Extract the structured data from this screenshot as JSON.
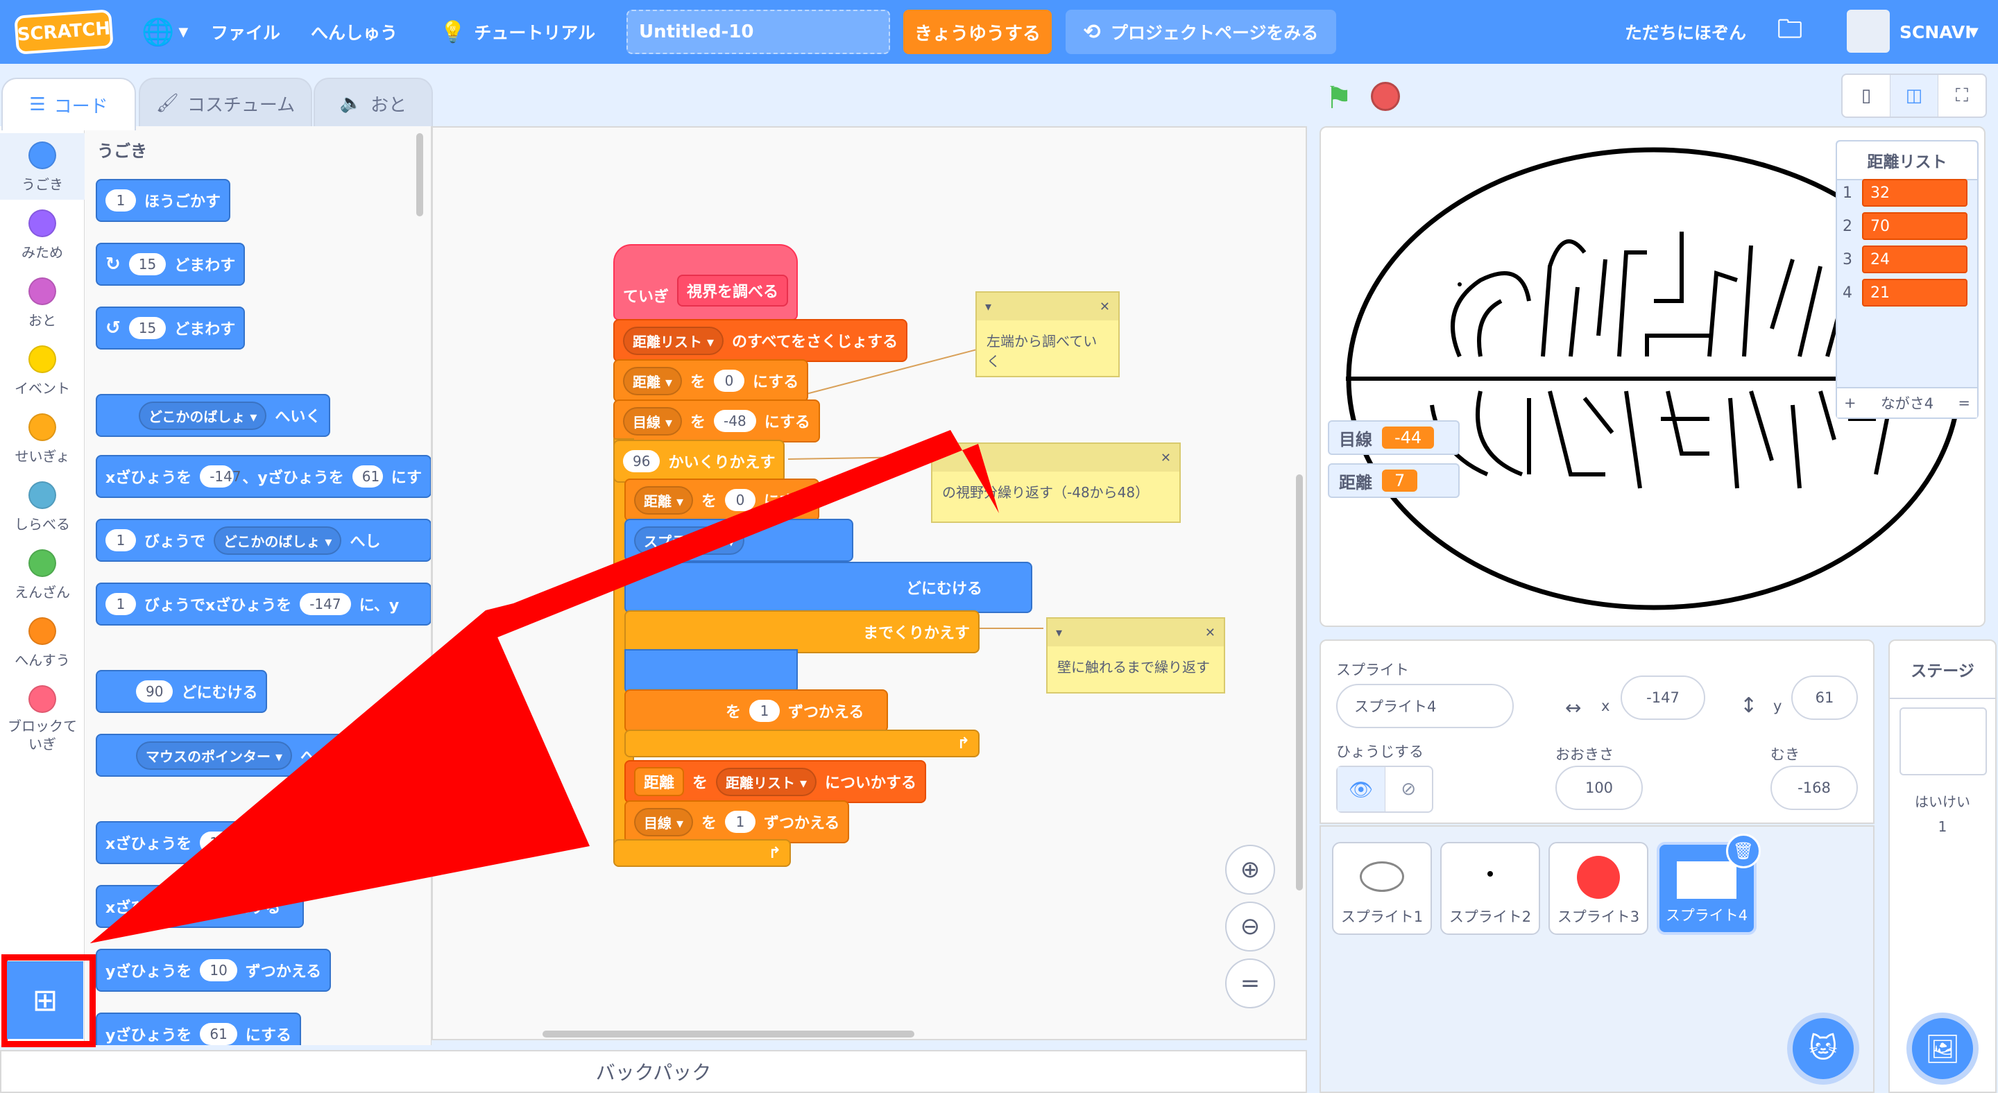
{
  "menubar": {
    "logo": "SCRATCH",
    "file": "ファイル",
    "edit": "へんしゅう",
    "tutorial": "チュートリアル",
    "project_title": "Untitled-10",
    "share": "きょうゆうする",
    "project_page": "プロジェクトページをみる",
    "save_now": "ただちにほぞん",
    "username": "SCNAVI"
  },
  "tabs": {
    "code": "コード",
    "costume": "コスチューム",
    "sound": "おと"
  },
  "categories": [
    {
      "label": "うごき",
      "color": "#4c97ff"
    },
    {
      "label": "みため",
      "color": "#9966ff"
    },
    {
      "label": "おと",
      "color": "#cf63cf"
    },
    {
      "label": "イベント",
      "color": "#ffd500"
    },
    {
      "label": "せいぎょ",
      "color": "#ffab19"
    },
    {
      "label": "しらべる",
      "color": "#5cb1d6"
    },
    {
      "label": "えんざん",
      "color": "#59c059"
    },
    {
      "label": "へんすう",
      "color": "#ff8c1a"
    },
    {
      "label": "ブロックていぎ",
      "color": "#ff6680"
    }
  ],
  "palette": {
    "heading": "うごき",
    "move": {
      "val": "1",
      "text": "ほうごかす"
    },
    "turn_right": {
      "val": "15",
      "text": "どまわす"
    },
    "turn_left": {
      "val": "15",
      "text": "どまわす"
    },
    "goto": {
      "dd": "どこかのばしょ",
      "text": "へいく"
    },
    "goto_xy": {
      "pre": "xざひょうを",
      "x": "-147",
      "mid": "、yざひょうを",
      "y": "61",
      "post": "にす"
    },
    "glide": {
      "val": "1",
      "pre": "びょうで",
      "dd": "どこかのばしょ",
      "post": "へし"
    },
    "glide_xy": {
      "val": "1",
      "pre": "びょうでxざひょうを",
      "x": "-147",
      "post": "に、y"
    },
    "point": {
      "val": "90",
      "text": "どにむける"
    },
    "point_towards": {
      "dd": "マウスのポインター",
      "text": "へ"
    },
    "change_x": {
      "pre": "xざひょうを",
      "val": "10"
    },
    "set_x": {
      "pre": "xざひょう",
      "post": "にする"
    },
    "change_y": {
      "pre": "yざひょうを",
      "val": "10",
      "post": "ずつかえる"
    },
    "set_y": {
      "pre": "yざひょうを",
      "val": "61",
      "post": "にする"
    }
  },
  "script": {
    "define": "ていぎ",
    "define_name": "視界を調べる",
    "delete_all": {
      "list": "距離リスト",
      "text": "のすべてをさくじょする"
    },
    "set_dist": {
      "var": "距離",
      "wo": "を",
      "val": "0",
      "text": "にする"
    },
    "set_eye": {
      "var": "目線",
      "wo": "を",
      "val": "-48",
      "text": "にする"
    },
    "repeat": {
      "val": "96",
      "text": "かいくりかえす"
    },
    "set_dist2": {
      "var": "距離",
      "wo": "を",
      "val": "0",
      "text": "にする"
    },
    "sprite_dd": "スプライト2",
    "point_towards": "どにむける",
    "repeat_until": "までくりかえす",
    "change_dist": {
      "wo": "を",
      "val": "1",
      "text": "ずつかえる"
    },
    "add_list": {
      "var": "距離",
      "wo": "を",
      "list": "距離リスト",
      "text": "についかする"
    },
    "change_eye": {
      "var": "目線",
      "wo": "を",
      "val": "1",
      "text": "ずつかえる"
    }
  },
  "notes": {
    "n1": "左端から調べていく",
    "n2": "の視野分繰り返す（-48から48）",
    "n3": "壁に触れるまで繰り返す"
  },
  "backpack": "バックパック",
  "stage": {
    "monitor_eye": {
      "label": "目線",
      "value": "-44"
    },
    "monitor_dist": {
      "label": "距離",
      "value": "7"
    },
    "list": {
      "title": "距離リスト",
      "items": [
        {
          "idx": "1",
          "val": "32"
        },
        {
          "idx": "2",
          "val": "70"
        },
        {
          "idx": "3",
          "val": "24"
        },
        {
          "idx": "4",
          "val": "21"
        }
      ],
      "add": "+",
      "length": "ながさ4",
      "resize": "="
    }
  },
  "sprite_info": {
    "label": "スプライト",
    "name": "スプライト4",
    "x_label": "x",
    "x": "-147",
    "y_label": "y",
    "y": "61",
    "show_label": "ひょうじする",
    "size_label": "おおきさ",
    "size": "100",
    "direction_label": "むき",
    "direction": "-168"
  },
  "sprites": [
    "スプライト1",
    "スプライト2",
    "スプライト3",
    "スプライト4"
  ],
  "stage_target": {
    "label": "ステージ",
    "backdrops_label": "はいけい",
    "backdrops_count": "1"
  }
}
